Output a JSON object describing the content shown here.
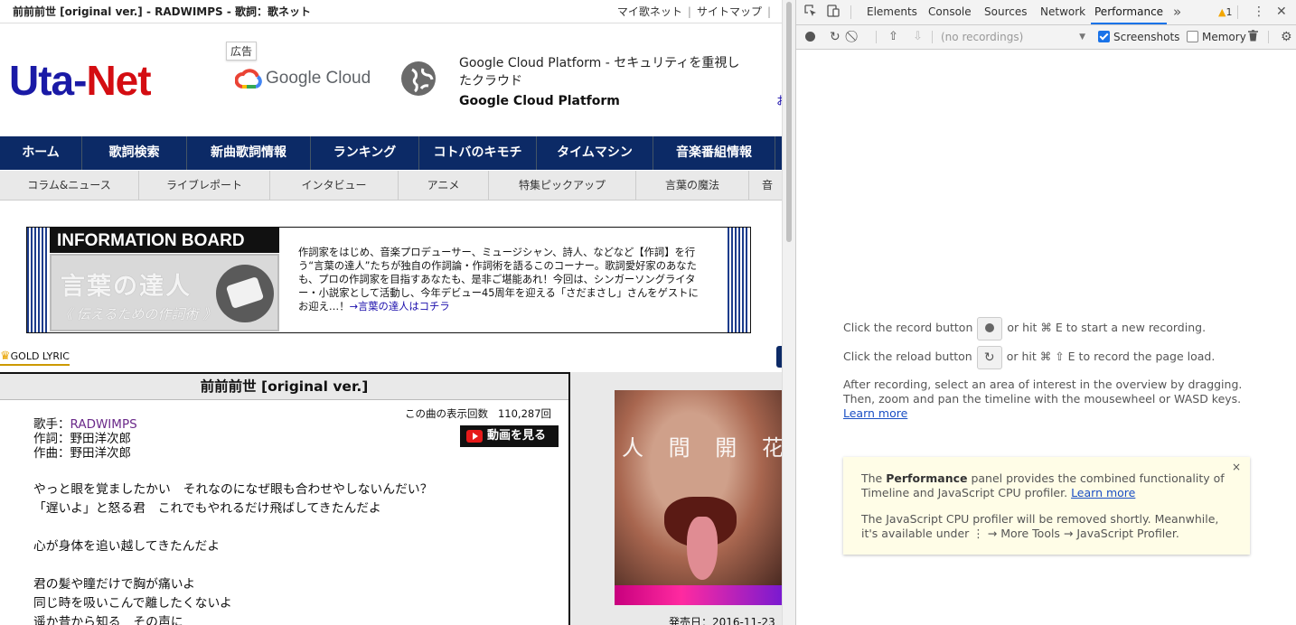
{
  "page": {
    "title": "前前前世 [original ver.] - RADWIMPS - 歌詞：歌ネット",
    "top_links": [
      "マイ歌ネット",
      "サイトマップ"
    ],
    "logo": {
      "part1": "Uta-",
      "part2": "Net"
    },
    "ad": {
      "badge": "広告",
      "logo_text": "Google Cloud",
      "title": "Google Cloud Platform - セキュリティを重視したクラウド",
      "brand": "Google Cloud Platform",
      "edge_char": "お"
    },
    "main_nav": [
      "ホーム",
      "歌詞検索",
      "新曲歌詞情報",
      "ランキング",
      "コトバのキモチ",
      "タイムマシン",
      "音楽番組情報"
    ],
    "sub_nav": [
      "コラム&ニュース",
      "ライブレポート",
      "インタビュー",
      "アニメ",
      "特集ピックアップ",
      "言葉の魔法",
      "音"
    ],
    "info_board": {
      "header": "INFORMATION BOARD",
      "banner_big": "言葉の達人",
      "banner_small": "《 伝えるための作詞術 》",
      "text": "作詞家をはじめ、音楽プロデューサー、ミュージシャン、詩人、などなど【作詞】を行う“言葉の達人”たちが独自の作詞論・作詞術を語るこのコーナー。歌詞愛好家のあなたも、プロの作詞家を目指すあなたも、是非ご堪能あれ！今回は、シンガーソングライター・小説家として活動し、今年デビュー45周年を迎える「さだまさし」さんをゲストにお迎え…！",
      "link": "→言葉の達人はコチラ"
    },
    "gold_lyric": "GOLD LYRIC",
    "song": {
      "title": "前前前世 [original ver.]",
      "view_label": "この曲の表示回数",
      "view_count": "110,287回",
      "video_button": "動画を見る",
      "singer_label": "歌手：",
      "singer": "RADWIMPS",
      "lyricist": "作詞：野田洋次郎",
      "composer": "作曲：野田洋次郎",
      "lyrics": "やっと眼を覚ましたかい　それなのになぜ眼も合わせやしないんだい？\n「遅いよ」と怒る君　これでもやれるだけ飛ばしてきたんだよ\n\n心が身体を追い越してきたんだよ\n\n君の髪や瞳だけで胸が痛いよ\n同じ時を吸いこんで離したくないよ\n遥か昔から知る　その声に",
      "jacket_text": "人 間 開 花",
      "release": "発売日：2016-11-23"
    }
  },
  "devtools": {
    "tabs": [
      "Elements",
      "Console",
      "Sources",
      "Network",
      "Performance"
    ],
    "active_tab": "Performance",
    "more": "»",
    "warning_count": "1",
    "toolbar": {
      "recordings": "(no recordings)",
      "screenshots": "Screenshots",
      "memory": "Memory"
    },
    "hints": {
      "record_pre": "Click the record button",
      "record_post": "or hit ⌘ E to start a new recording.",
      "reload_pre": "Click the reload button",
      "reload_post": "or hit ⌘ ⇧ E to record the page load.",
      "after1": "After recording, select an area of interest in the overview by dragging.",
      "after2": "Then, zoom and pan the timeline with the mousewheel or WASD keys.",
      "learn_more": "Learn more"
    },
    "note": {
      "line1_pre": "The ",
      "line1_bold": "Performance",
      "line1_post": " panel provides the combined functionality of Timeline and JavaScript CPU profiler. ",
      "line1_link": "Learn more",
      "line2": "The JavaScript CPU profiler will be removed shortly. Meanwhile, it's available under ⋮ → More Tools → JavaScript Profiler.",
      "close": "×"
    }
  }
}
